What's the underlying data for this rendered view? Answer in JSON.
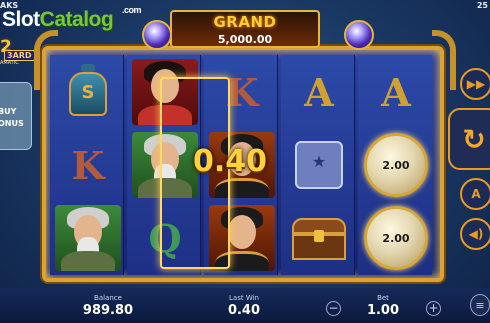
{
  "top": {
    "studio_label": "AKS",
    "clock": "25",
    "watermark_part1": "Slot",
    "watermark_part2": "Catalog",
    "watermark_suffix": ".com"
  },
  "game_logo": {
    "number": "2",
    "word": "3ARD",
    "sub": "AMATIC"
  },
  "jackpot": {
    "title": "GRAND",
    "value": "5,000.00"
  },
  "buy_bonus": {
    "line1": "BUY",
    "line2": "ONUS"
  },
  "reels": [
    [
      "bell-icon",
      "K",
      "sage"
    ],
    [
      "lady",
      "sage",
      "Q"
    ],
    [
      "K",
      "emperor",
      "emperor"
    ],
    [
      "A",
      "scroll-icon",
      "chest-icon"
    ],
    [
      "A",
      "coin",
      "coin"
    ]
  ],
  "coin_values": [
    "2.00",
    "2.00"
  ],
  "win_amount": "0.40",
  "controls": {
    "turbo_icon": "fast-forward-icon",
    "spin_icon": "spin-arrows-icon",
    "auto_icon": "autoplay-icon",
    "sound_icon": "speaker-icon",
    "menu_icon": "coins-stack-icon"
  },
  "bottom": {
    "balance_label": "Balance",
    "balance_value": "989.80",
    "lastwin_label": "Last Win",
    "lastwin_value": "0.40",
    "bet_label": "Bet",
    "bet_value": "1.00",
    "minus": "−",
    "plus": "+"
  },
  "colors": {
    "frame_gold": "#d9a431",
    "accent_orange": "#e79b24",
    "win_yellow": "#ffd23a"
  }
}
